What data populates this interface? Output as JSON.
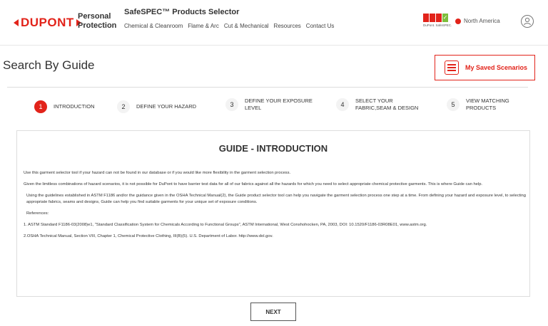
{
  "header": {
    "logo_text": "DUPONT",
    "brand_sub": [
      "Personal",
      "Protection"
    ],
    "app_title": "SafeSPEC™ Products Selector",
    "nav": [
      "Chemical & Cleanroom",
      "Flame & Arc",
      "Cut & Mechanical",
      "Resources",
      "Contact Us"
    ],
    "safespec_label": "DuPont. SafeSPEC.",
    "region": "North America",
    "icons": {
      "user": "user-circle-icon",
      "globe": "globe-icon",
      "check": "checkmark-icon"
    },
    "colors": {
      "brand": "#e2231a",
      "accent_green": "#7cbe3c"
    }
  },
  "page": {
    "title": "Search By Guide",
    "saved_scenarios_label": "My Saved Scenarios",
    "saved_scenarios_icon": "list-icon"
  },
  "steps": [
    {
      "num": "1",
      "label": "INTRODUCTION",
      "active": true
    },
    {
      "num": "2",
      "label": "DEFINE YOUR HAZARD",
      "active": false
    },
    {
      "num": "3",
      "label": "DEFINE YOUR EXPOSURE LEVEL",
      "active": false
    },
    {
      "num": "4",
      "label": "SELECT YOUR FABRIC,SEAM & DESIGN",
      "active": false
    },
    {
      "num": "5",
      "label": "VIEW MATCHING PRODUCTS",
      "active": false
    }
  ],
  "guide": {
    "title": "GUIDE - INTRODUCTION",
    "paragraphs": [
      "Use this garment selector tool if your hazard can not be found in our database or if you would like more flexibility in the garment selection process.",
      "Given the limitless combinations of hazard scenarios, it is not possible for DuPont to have barrier test data for all of our fabrics against all the hazards for which you need to select appropriate chemical protective garments. This is where Guide can help.",
      "Using the guidelines established in ASTM F1186 and/or the guidance given in the OSHA Technical Manual(2), the Guide product selector tool can help you navigate the garment selection process one step at a time. From defining your hazard and exposure level, to selecting appropriate fabrics, seams and designs, Guide can help you find suitable garments for your unique set of exposure conditions.",
      "References:",
      "1. ASTM Standard F1186-03(2008)e1, \"Standard Classification System for Chemicals According to Functional Groups\", ASTM International, West Conshohocken, PA, 2003, DOI: 10.1520/F1186-03R08E01, www.astm.org.",
      "2.OSHA Technical Manual, Section VIII, Chapter 1, Chemical Protective Clothing, III(B)(5). U.S. Department of Labor. http://www.dol.gov."
    ]
  },
  "next_label": "NEXT"
}
